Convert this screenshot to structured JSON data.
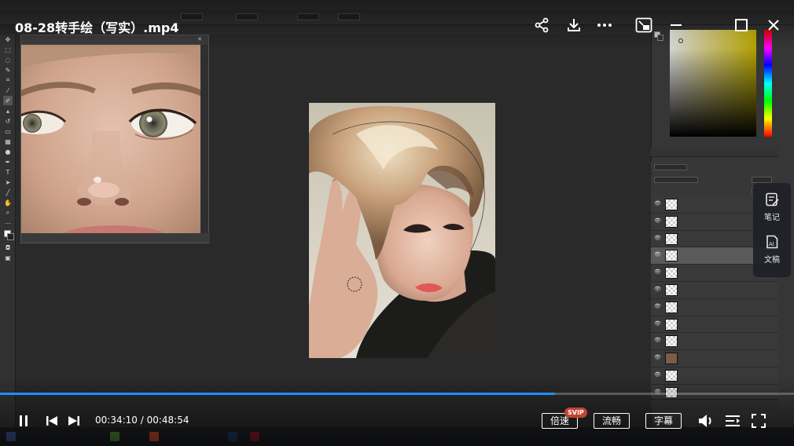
{
  "video": {
    "title": "08-28转手绘（写实）.mp4",
    "time_current": "00:34:10",
    "time_total": "00:48:54",
    "time_separator": " / ",
    "progress_fraction": 0.699,
    "speed_label": "倍速",
    "speed_badge": "SVIP",
    "quality_label": "流畅",
    "subtitle_label": "字幕"
  },
  "side_panel": {
    "notes_label": "笔记",
    "transcript_label": "文稿"
  },
  "colors": {
    "accent": "#1e90ff",
    "badge": "#c1442f"
  }
}
